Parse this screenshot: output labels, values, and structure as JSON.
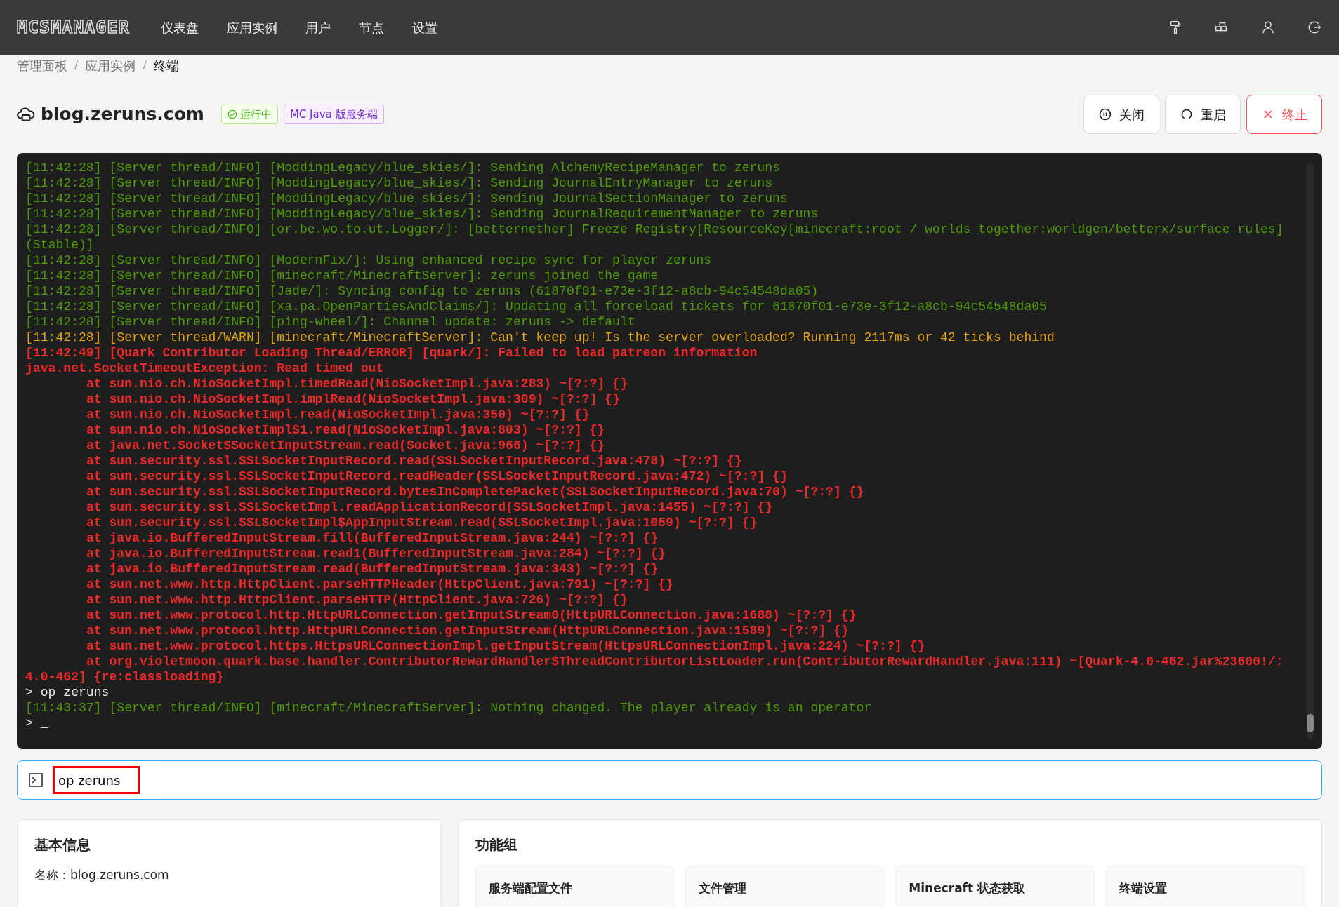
{
  "navbar": {
    "logo": "MCSMANAGER",
    "items": [
      {
        "label": "仪表盘",
        "selected": false
      },
      {
        "label": "应用实例",
        "selected": false
      },
      {
        "label": "用户",
        "selected": false
      },
      {
        "label": "节点",
        "selected": false
      },
      {
        "label": "设置",
        "selected": false
      }
    ]
  },
  "breadcrumb": {
    "separator": "/",
    "items": [
      "管理面板",
      "应用实例",
      "终端"
    ]
  },
  "instance": {
    "name": "blog.zeruns.com",
    "status": "运行中",
    "type": "MC Java 版服务端"
  },
  "actions": [
    {
      "label": "关闭",
      "kind": "pause"
    },
    {
      "label": "重启",
      "kind": "restart"
    },
    {
      "label": "终止",
      "kind": "kill"
    }
  ],
  "terminal": {
    "lines": [
      {
        "kind": "info",
        "text": "[11:42:28] [Server thread/INFO] [ModdingLegacy/blue_skies/]: Sending AlchemyRecipeManager to zeruns"
      },
      {
        "kind": "info",
        "text": "[11:42:28] [Server thread/INFO] [ModdingLegacy/blue_skies/]: Sending JournalEntryManager to zeruns"
      },
      {
        "kind": "info",
        "text": "[11:42:28] [Server thread/INFO] [ModdingLegacy/blue_skies/]: Sending JournalSectionManager to zeruns"
      },
      {
        "kind": "info",
        "text": "[11:42:28] [Server thread/INFO] [ModdingLegacy/blue_skies/]: Sending JournalRequirementManager to zeruns"
      },
      {
        "kind": "info",
        "text": "[11:42:28] [Server thread/INFO] [or.be.wo.to.ut.Logger/]: [betternether] Freeze Registry[ResourceKey[minecraft:root / worlds_together:worldgen/betterx/surface_rules] (Stable)]"
      },
      {
        "kind": "info",
        "text": "[11:42:28] [Server thread/INFO] [ModernFix/]: Using enhanced recipe sync for player zeruns"
      },
      {
        "kind": "info",
        "text": "[11:42:28] [Server thread/INFO] [minecraft/MinecraftServer]: zeruns joined the game"
      },
      {
        "kind": "info",
        "text": "[11:42:28] [Server thread/INFO] [Jade/]: Syncing config to zeruns (61870f01-e73e-3f12-a8cb-94c54548da05)"
      },
      {
        "kind": "info",
        "text": "[11:42:28] [Server thread/INFO] [xa.pa.OpenPartiesAndClaims/]: Updating all forceload tickets for 61870f01-e73e-3f12-a8cb-94c54548da05"
      },
      {
        "kind": "info",
        "text": "[11:42:28] [Server thread/INFO] [ping-wheel/]: Channel update: zeruns -> default"
      },
      {
        "kind": "warn",
        "text": "[11:42:28] [Server thread/WARN] [minecraft/MinecraftServer]: Can't keep up! Is the server overloaded? Running 2117ms or 42 ticks behind"
      },
      {
        "kind": "error",
        "text": "[11:42:49] [Quark Contributor Loading Thread/ERROR] [quark/]: Failed to load patreon information"
      },
      {
        "kind": "error",
        "text": "java.net.SocketTimeoutException: Read timed out"
      },
      {
        "kind": "error",
        "text": "        at sun.nio.ch.NioSocketImpl.timedRead(NioSocketImpl.java:283) ~[?:?] {}"
      },
      {
        "kind": "error",
        "text": "        at sun.nio.ch.NioSocketImpl.implRead(NioSocketImpl.java:309) ~[?:?] {}"
      },
      {
        "kind": "error",
        "text": "        at sun.nio.ch.NioSocketImpl.read(NioSocketImpl.java:350) ~[?:?] {}"
      },
      {
        "kind": "error",
        "text": "        at sun.nio.ch.NioSocketImpl$1.read(NioSocketImpl.java:803) ~[?:?] {}"
      },
      {
        "kind": "error",
        "text": "        at java.net.Socket$SocketInputStream.read(Socket.java:966) ~[?:?] {}"
      },
      {
        "kind": "error",
        "text": "        at sun.security.ssl.SSLSocketInputRecord.read(SSLSocketInputRecord.java:478) ~[?:?] {}"
      },
      {
        "kind": "error",
        "text": "        at sun.security.ssl.SSLSocketInputRecord.readHeader(SSLSocketInputRecord.java:472) ~[?:?] {}"
      },
      {
        "kind": "error",
        "text": "        at sun.security.ssl.SSLSocketInputRecord.bytesInCompletePacket(SSLSocketInputRecord.java:70) ~[?:?] {}"
      },
      {
        "kind": "error",
        "text": "        at sun.security.ssl.SSLSocketImpl.readApplicationRecord(SSLSocketImpl.java:1455) ~[?:?] {}"
      },
      {
        "kind": "error",
        "text": "        at sun.security.ssl.SSLSocketImpl$AppInputStream.read(SSLSocketImpl.java:1059) ~[?:?] {}"
      },
      {
        "kind": "error",
        "text": "        at java.io.BufferedInputStream.fill(BufferedInputStream.java:244) ~[?:?] {}"
      },
      {
        "kind": "error",
        "text": "        at java.io.BufferedInputStream.read1(BufferedInputStream.java:284) ~[?:?] {}"
      },
      {
        "kind": "error",
        "text": "        at java.io.BufferedInputStream.read(BufferedInputStream.java:343) ~[?:?] {}"
      },
      {
        "kind": "error",
        "text": "        at sun.net.www.http.HttpClient.parseHTTPHeader(HttpClient.java:791) ~[?:?] {}"
      },
      {
        "kind": "error",
        "text": "        at sun.net.www.http.HttpClient.parseHTTP(HttpClient.java:726) ~[?:?] {}"
      },
      {
        "kind": "error",
        "text": "        at sun.net.www.protocol.http.HttpURLConnection.getInputStream0(HttpURLConnection.java:1688) ~[?:?] {}"
      },
      {
        "kind": "error",
        "text": "        at sun.net.www.protocol.http.HttpURLConnection.getInputStream(HttpURLConnection.java:1589) ~[?:?] {}"
      },
      {
        "kind": "error",
        "text": "        at sun.net.www.protocol.https.HttpsURLConnectionImpl.getInputStream(HttpsURLConnectionImpl.java:224) ~[?:?] {}"
      },
      {
        "kind": "error",
        "text": "        at org.violetmoon.quark.base.handler.ContributorRewardHandler$ThreadContributorListLoader.run(ContributorRewardHandler.java:111) ~[Quark-4.0-462.jar%23600!/:4.0-462] {re:classloading}"
      },
      {
        "kind": "plain",
        "text": "> op zeruns"
      },
      {
        "kind": "info",
        "text": "[11:43:37] [Server thread/INFO] [minecraft/MinecraftServer]: Nothing changed. The player already is an operator"
      },
      {
        "kind": "plain",
        "text": "> _"
      }
    ]
  },
  "command": {
    "value": "op zeruns",
    "highlighted": true
  },
  "info_card": {
    "title": "基本信息",
    "name_label": "名称：",
    "name_value": "blog.zeruns.com"
  },
  "features": {
    "title": "功能组",
    "items": [
      "服务端配置文件",
      "文件管理",
      "Minecraft 状态获取",
      "终端设置"
    ]
  }
}
